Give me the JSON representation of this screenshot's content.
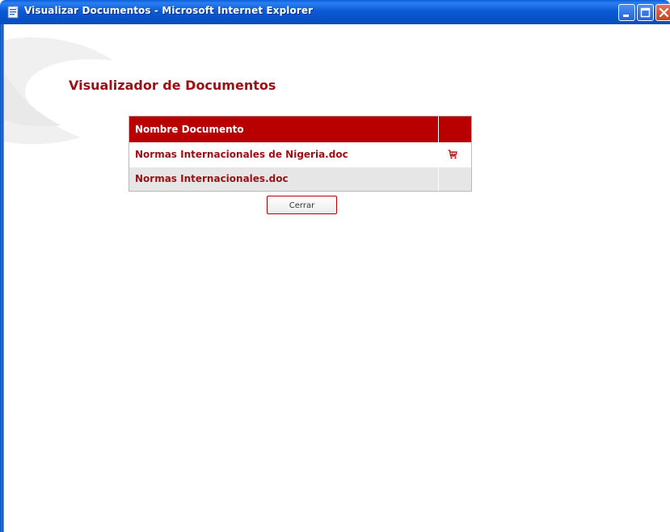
{
  "window": {
    "title": "Visualizar Documentos - Microsoft Internet Explorer",
    "title_bar_color": "#0a5fd9",
    "controls": [
      "minimize-icon",
      "maximize-icon",
      "close-icon"
    ]
  },
  "page": {
    "title": "Visualizador de Documentos",
    "accent_color": "#9c0f14",
    "header_color": "#b80000"
  },
  "documents_table": {
    "column_header": "Nombre Documento",
    "rows": [
      {
        "name": "Normas Internacionales de Nigeria.doc",
        "action_icon": "cart-icon"
      },
      {
        "name": "Normas Internacionales.doc",
        "action_icon": ""
      }
    ]
  },
  "close_button": {
    "label": "Cerrar"
  }
}
